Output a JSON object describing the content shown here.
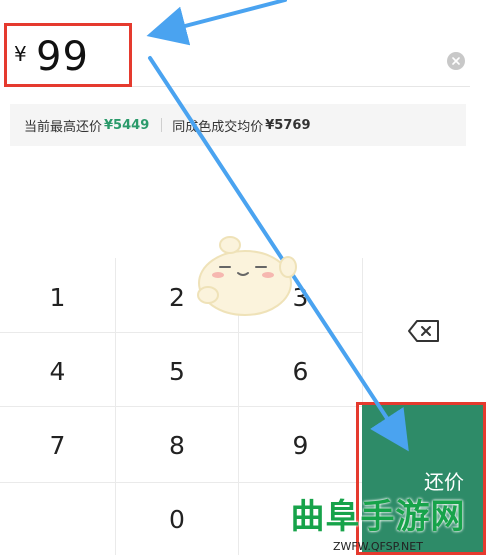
{
  "price_input": {
    "currency_symbol": "¥",
    "value": "99"
  },
  "price_info": {
    "highest_offer_label": "当前最高还价",
    "highest_offer_value": "¥5449",
    "avg_price_label": "同成色成交均价",
    "avg_price_value": "¥5769"
  },
  "keypad": {
    "keys": [
      "1",
      "2",
      "3",
      "4",
      "5",
      "6",
      "7",
      "8",
      "9",
      "0"
    ],
    "backspace_icon": "backspace-icon",
    "submit_label": "还价"
  },
  "colors": {
    "accent_green": "#2e8b68",
    "highlight_red": "#e53a2e",
    "arrow_blue": "#4aa3f0"
  },
  "watermark": {
    "main": "曲阜手游网",
    "sub": "ZWFW.QFSP.NET"
  }
}
